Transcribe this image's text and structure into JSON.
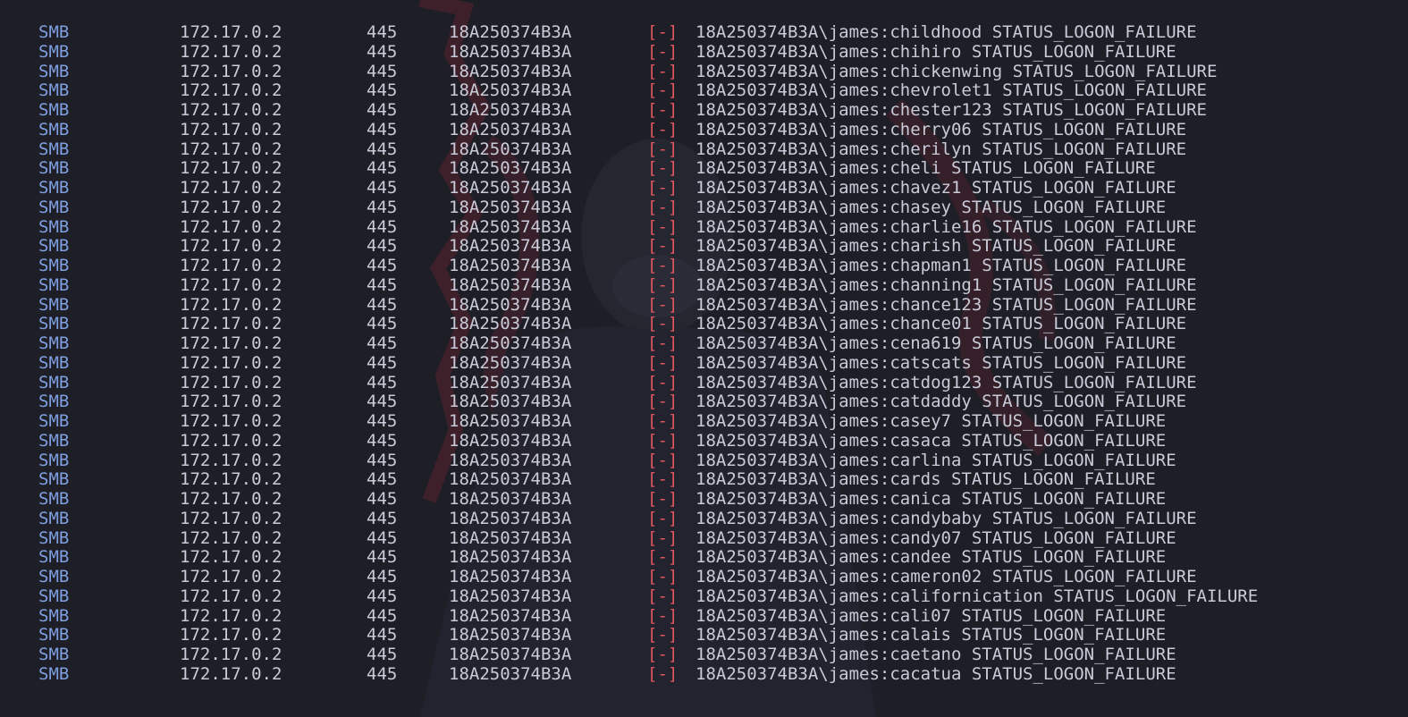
{
  "colors": {
    "background": "#1d1e26",
    "protocol": "#7f9fe0",
    "text": "#c9cbd8",
    "failure_marker": "#e0565f"
  },
  "rows": [
    {
      "proto": "SMB",
      "ip": "172.17.0.2",
      "port": "445",
      "host": "18A250374B3A",
      "marker": "[-]",
      "message": "18A250374B3A\\james:childhood STATUS_LOGON_FAILURE"
    },
    {
      "proto": "SMB",
      "ip": "172.17.0.2",
      "port": "445",
      "host": "18A250374B3A",
      "marker": "[-]",
      "message": "18A250374B3A\\james:chihiro STATUS_LOGON_FAILURE"
    },
    {
      "proto": "SMB",
      "ip": "172.17.0.2",
      "port": "445",
      "host": "18A250374B3A",
      "marker": "[-]",
      "message": "18A250374B3A\\james:chickenwing STATUS_LOGON_FAILURE"
    },
    {
      "proto": "SMB",
      "ip": "172.17.0.2",
      "port": "445",
      "host": "18A250374B3A",
      "marker": "[-]",
      "message": "18A250374B3A\\james:chevrolet1 STATUS_LOGON_FAILURE"
    },
    {
      "proto": "SMB",
      "ip": "172.17.0.2",
      "port": "445",
      "host": "18A250374B3A",
      "marker": "[-]",
      "message": "18A250374B3A\\james:chester123 STATUS_LOGON_FAILURE"
    },
    {
      "proto": "SMB",
      "ip": "172.17.0.2",
      "port": "445",
      "host": "18A250374B3A",
      "marker": "[-]",
      "message": "18A250374B3A\\james:cherry06 STATUS_LOGON_FAILURE"
    },
    {
      "proto": "SMB",
      "ip": "172.17.0.2",
      "port": "445",
      "host": "18A250374B3A",
      "marker": "[-]",
      "message": "18A250374B3A\\james:cherilyn STATUS_LOGON_FAILURE"
    },
    {
      "proto": "SMB",
      "ip": "172.17.0.2",
      "port": "445",
      "host": "18A250374B3A",
      "marker": "[-]",
      "message": "18A250374B3A\\james:cheli STATUS_LOGON_FAILURE"
    },
    {
      "proto": "SMB",
      "ip": "172.17.0.2",
      "port": "445",
      "host": "18A250374B3A",
      "marker": "[-]",
      "message": "18A250374B3A\\james:chavez1 STATUS_LOGON_FAILURE"
    },
    {
      "proto": "SMB",
      "ip": "172.17.0.2",
      "port": "445",
      "host": "18A250374B3A",
      "marker": "[-]",
      "message": "18A250374B3A\\james:chasey STATUS_LOGON_FAILURE"
    },
    {
      "proto": "SMB",
      "ip": "172.17.0.2",
      "port": "445",
      "host": "18A250374B3A",
      "marker": "[-]",
      "message": "18A250374B3A\\james:charlie16 STATUS_LOGON_FAILURE"
    },
    {
      "proto": "SMB",
      "ip": "172.17.0.2",
      "port": "445",
      "host": "18A250374B3A",
      "marker": "[-]",
      "message": "18A250374B3A\\james:charish STATUS_LOGON_FAILURE"
    },
    {
      "proto": "SMB",
      "ip": "172.17.0.2",
      "port": "445",
      "host": "18A250374B3A",
      "marker": "[-]",
      "message": "18A250374B3A\\james:chapman1 STATUS_LOGON_FAILURE"
    },
    {
      "proto": "SMB",
      "ip": "172.17.0.2",
      "port": "445",
      "host": "18A250374B3A",
      "marker": "[-]",
      "message": "18A250374B3A\\james:channing1 STATUS_LOGON_FAILURE"
    },
    {
      "proto": "SMB",
      "ip": "172.17.0.2",
      "port": "445",
      "host": "18A250374B3A",
      "marker": "[-]",
      "message": "18A250374B3A\\james:chance123 STATUS_LOGON_FAILURE"
    },
    {
      "proto": "SMB",
      "ip": "172.17.0.2",
      "port": "445",
      "host": "18A250374B3A",
      "marker": "[-]",
      "message": "18A250374B3A\\james:chance01 STATUS_LOGON_FAILURE"
    },
    {
      "proto": "SMB",
      "ip": "172.17.0.2",
      "port": "445",
      "host": "18A250374B3A",
      "marker": "[-]",
      "message": "18A250374B3A\\james:cena619 STATUS_LOGON_FAILURE"
    },
    {
      "proto": "SMB",
      "ip": "172.17.0.2",
      "port": "445",
      "host": "18A250374B3A",
      "marker": "[-]",
      "message": "18A250374B3A\\james:catscats STATUS_LOGON_FAILURE"
    },
    {
      "proto": "SMB",
      "ip": "172.17.0.2",
      "port": "445",
      "host": "18A250374B3A",
      "marker": "[-]",
      "message": "18A250374B3A\\james:catdog123 STATUS_LOGON_FAILURE"
    },
    {
      "proto": "SMB",
      "ip": "172.17.0.2",
      "port": "445",
      "host": "18A250374B3A",
      "marker": "[-]",
      "message": "18A250374B3A\\james:catdaddy STATUS_LOGON_FAILURE"
    },
    {
      "proto": "SMB",
      "ip": "172.17.0.2",
      "port": "445",
      "host": "18A250374B3A",
      "marker": "[-]",
      "message": "18A250374B3A\\james:casey7 STATUS_LOGON_FAILURE"
    },
    {
      "proto": "SMB",
      "ip": "172.17.0.2",
      "port": "445",
      "host": "18A250374B3A",
      "marker": "[-]",
      "message": "18A250374B3A\\james:casaca STATUS_LOGON_FAILURE"
    },
    {
      "proto": "SMB",
      "ip": "172.17.0.2",
      "port": "445",
      "host": "18A250374B3A",
      "marker": "[-]",
      "message": "18A250374B3A\\james:carlina STATUS_LOGON_FAILURE"
    },
    {
      "proto": "SMB",
      "ip": "172.17.0.2",
      "port": "445",
      "host": "18A250374B3A",
      "marker": "[-]",
      "message": "18A250374B3A\\james:cards STATUS_LOGON_FAILURE"
    },
    {
      "proto": "SMB",
      "ip": "172.17.0.2",
      "port": "445",
      "host": "18A250374B3A",
      "marker": "[-]",
      "message": "18A250374B3A\\james:canica STATUS_LOGON_FAILURE"
    },
    {
      "proto": "SMB",
      "ip": "172.17.0.2",
      "port": "445",
      "host": "18A250374B3A",
      "marker": "[-]",
      "message": "18A250374B3A\\james:candybaby STATUS_LOGON_FAILURE"
    },
    {
      "proto": "SMB",
      "ip": "172.17.0.2",
      "port": "445",
      "host": "18A250374B3A",
      "marker": "[-]",
      "message": "18A250374B3A\\james:candy07 STATUS_LOGON_FAILURE"
    },
    {
      "proto": "SMB",
      "ip": "172.17.0.2",
      "port": "445",
      "host": "18A250374B3A",
      "marker": "[-]",
      "message": "18A250374B3A\\james:candee STATUS_LOGON_FAILURE"
    },
    {
      "proto": "SMB",
      "ip": "172.17.0.2",
      "port": "445",
      "host": "18A250374B3A",
      "marker": "[-]",
      "message": "18A250374B3A\\james:cameron02 STATUS_LOGON_FAILURE"
    },
    {
      "proto": "SMB",
      "ip": "172.17.0.2",
      "port": "445",
      "host": "18A250374B3A",
      "marker": "[-]",
      "message": "18A250374B3A\\james:californication STATUS_LOGON_FAILURE"
    },
    {
      "proto": "SMB",
      "ip": "172.17.0.2",
      "port": "445",
      "host": "18A250374B3A",
      "marker": "[-]",
      "message": "18A250374B3A\\james:cali07 STATUS_LOGON_FAILURE"
    },
    {
      "proto": "SMB",
      "ip": "172.17.0.2",
      "port": "445",
      "host": "18A250374B3A",
      "marker": "[-]",
      "message": "18A250374B3A\\james:calais STATUS_LOGON_FAILURE"
    },
    {
      "proto": "SMB",
      "ip": "172.17.0.2",
      "port": "445",
      "host": "18A250374B3A",
      "marker": "[-]",
      "message": "18A250374B3A\\james:caetano STATUS_LOGON_FAILURE"
    },
    {
      "proto": "SMB",
      "ip": "172.17.0.2",
      "port": "445",
      "host": "18A250374B3A",
      "marker": "[-]",
      "message": "18A250374B3A\\james:cacatua STATUS_LOGON_FAILURE"
    }
  ]
}
